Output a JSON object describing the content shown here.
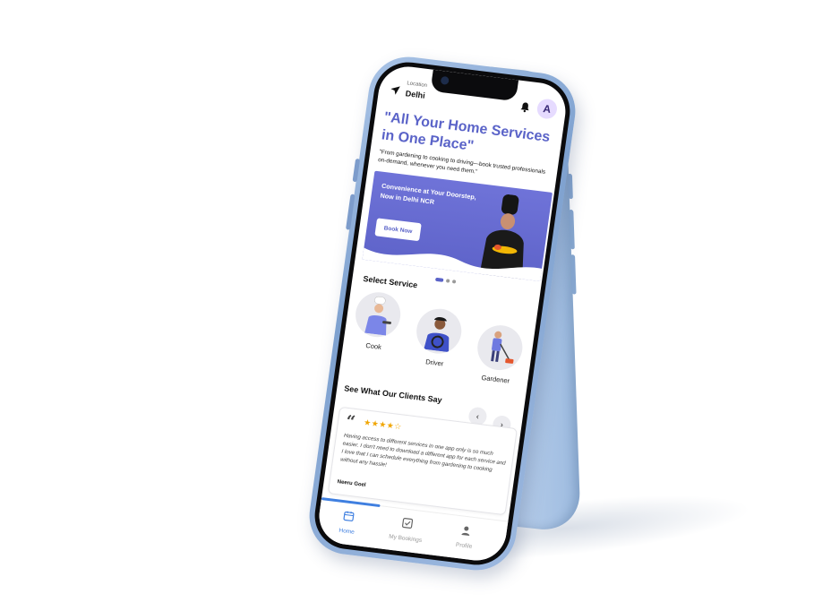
{
  "header": {
    "location_label": "Location",
    "location_value": "Delhi",
    "avatar_initial": "A"
  },
  "hero": {
    "title": "\"All Your Home Services in One Place\"",
    "subtitle": "\"From gardening to cooking to driving—book trusted professionals on-demand, whenever you need them.\""
  },
  "banner": {
    "text_line1": "Convenience at Your Doorstep,",
    "text_line2": "Now in Delhi NCR",
    "button_label": "Book Now"
  },
  "carousel": {
    "slides": 3,
    "active": 0
  },
  "services": {
    "title": "Select Service",
    "items": [
      {
        "label": "Cook"
      },
      {
        "label": "Driver"
      },
      {
        "label": "Gardener"
      }
    ]
  },
  "clients": {
    "title": "See What Our Clients Say",
    "prev_label": "‹",
    "next_label": "›",
    "review": {
      "stars_text": "★★★★☆",
      "rating": 4,
      "text": "Having access to different services in one app only is so much easier. I don't need to download a different app for each service and I love that I can schedule everything from gardening to cooking without any hassle!",
      "author": "Neeru Goel"
    }
  },
  "nav": {
    "items": [
      {
        "label": "Home"
      },
      {
        "label": "My Bookings"
      },
      {
        "label": "Profile"
      }
    ]
  },
  "colors": {
    "accent": "#5a63c8",
    "nav_active": "#3f7fe0",
    "star": "#f0a500",
    "phone_body": "#9cb8df"
  }
}
